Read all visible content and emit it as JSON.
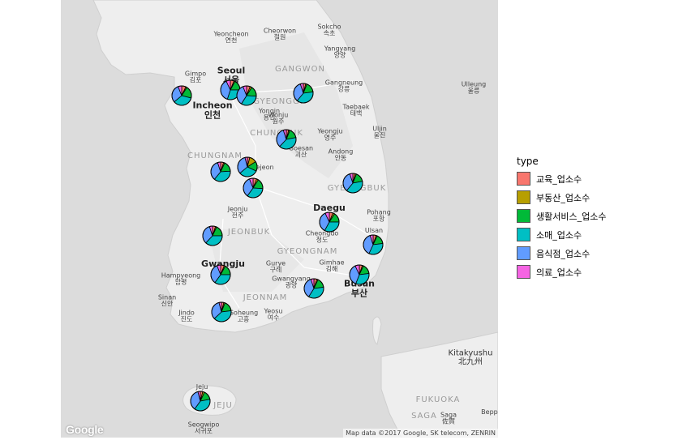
{
  "legend": {
    "title": "type",
    "items": [
      {
        "label": "교육_업소수",
        "color": "#F8766D"
      },
      {
        "label": "부동산_업소수",
        "color": "#B79F00"
      },
      {
        "label": "생활서비스_업소수",
        "color": "#00BA38"
      },
      {
        "label": "소매_업소수",
        "color": "#00BFC4"
      },
      {
        "label": "음식점_업소수",
        "color": "#619CFF"
      },
      {
        "label": "의료_업소수",
        "color": "#F564E3"
      }
    ]
  },
  "map": {
    "attribution": "Map data ©2017 Google, SK telecom, ZENRIN",
    "logo_text": "Google",
    "labels": [
      {
        "en": "Yeoncheon",
        "ko": "연천",
        "kind": "city"
      },
      {
        "en": "Cheorwon",
        "ko": "철원",
        "kind": "city"
      },
      {
        "en": "Sokcho",
        "ko": "속초",
        "kind": "city"
      },
      {
        "en": "Yangyang",
        "ko": "양양",
        "kind": "city"
      },
      {
        "en": "GANGWON",
        "ko": "",
        "kind": "region"
      },
      {
        "en": "Gimpo",
        "ko": "김포",
        "kind": "city"
      },
      {
        "en": "Seoul",
        "ko": "서울",
        "kind": "city-big"
      },
      {
        "en": "Gangneung",
        "ko": "강릉",
        "kind": "city"
      },
      {
        "en": "Ulleung",
        "ko": "울릉",
        "kind": "city"
      },
      {
        "en": "GYEONGGI",
        "ko": "",
        "kind": "region"
      },
      {
        "en": "Incheon",
        "ko": "인천",
        "kind": "city-big"
      },
      {
        "en": "Yongin",
        "ko": "용인",
        "kind": "city"
      },
      {
        "en": "Wonju",
        "ko": "원주",
        "kind": "city"
      },
      {
        "en": "Taebaek",
        "ko": "태백",
        "kind": "city"
      },
      {
        "en": "CHUNGBUK",
        "ko": "",
        "kind": "region"
      },
      {
        "en": "Yeongju",
        "ko": "영주",
        "kind": "city"
      },
      {
        "en": "Uljin",
        "ko": "울진",
        "kind": "city"
      },
      {
        "en": "Goesan",
        "ko": "괴산",
        "kind": "city"
      },
      {
        "en": "Andong",
        "ko": "안동",
        "kind": "city"
      },
      {
        "en": "CHUNGNAM",
        "ko": "",
        "kind": "region"
      },
      {
        "en": "Daejeon",
        "ko": "",
        "kind": "city"
      },
      {
        "en": "GYEONGBUK",
        "ko": "",
        "kind": "region"
      },
      {
        "en": "Jeonju",
        "ko": "전주",
        "kind": "city"
      },
      {
        "en": "Daegu",
        "ko": "",
        "kind": "city-big"
      },
      {
        "en": "Pohang",
        "ko": "포항",
        "kind": "city"
      },
      {
        "en": "JEONBUK",
        "ko": "",
        "kind": "region"
      },
      {
        "en": "Cheongdo",
        "ko": "청도",
        "kind": "city"
      },
      {
        "en": "Ulsan",
        "ko": "",
        "kind": "city"
      },
      {
        "en": "GYEONGNAM",
        "ko": "",
        "kind": "region"
      },
      {
        "en": "Gwangju",
        "ko": "",
        "kind": "city-big"
      },
      {
        "en": "Gurye",
        "ko": "구례",
        "kind": "city"
      },
      {
        "en": "Gimhae",
        "ko": "김해",
        "kind": "city"
      },
      {
        "en": "Hampyeong",
        "ko": "함평",
        "kind": "city"
      },
      {
        "en": "Gwangyang",
        "ko": "광양",
        "kind": "city"
      },
      {
        "en": "Busan",
        "ko": "부산",
        "kind": "city-big"
      },
      {
        "en": "JEONNAM",
        "ko": "",
        "kind": "region"
      },
      {
        "en": "Sinan",
        "ko": "신안",
        "kind": "city"
      },
      {
        "en": "Jindo",
        "ko": "진도",
        "kind": "city"
      },
      {
        "en": "Goheung",
        "ko": "고흥",
        "kind": "city"
      },
      {
        "en": "Yeosu",
        "ko": "여수",
        "kind": "city"
      },
      {
        "en": "Kitakyushu",
        "ko": "北九州",
        "kind": "intl"
      },
      {
        "en": "FUKUOKA",
        "ko": "",
        "kind": "region"
      },
      {
        "en": "SAGA",
        "ko": "",
        "kind": "region"
      },
      {
        "en": "Saga",
        "ko": "佐賀",
        "kind": "city"
      },
      {
        "en": "Beppu",
        "ko": "",
        "kind": "city"
      },
      {
        "en": "Jeju",
        "ko": "",
        "kind": "city"
      },
      {
        "en": "JEJU",
        "ko": "",
        "kind": "region"
      },
      {
        "en": "Seogwipo",
        "ko": "서귀포",
        "kind": "city"
      }
    ]
  },
  "pies": [
    {
      "name": "pie-incheon",
      "values": [
        0.07,
        0.02,
        0.2,
        0.35,
        0.3,
        0.06
      ]
    },
    {
      "name": "pie-seoul-west",
      "values": [
        0.06,
        0.02,
        0.17,
        0.3,
        0.38,
        0.07
      ]
    },
    {
      "name": "pie-seoul-east",
      "values": [
        0.06,
        0.03,
        0.17,
        0.33,
        0.35,
        0.06
      ]
    },
    {
      "name": "pie-gangwon",
      "values": [
        0.04,
        0.02,
        0.17,
        0.38,
        0.34,
        0.05
      ]
    },
    {
      "name": "pie-chungbuk",
      "values": [
        0.04,
        0.02,
        0.16,
        0.4,
        0.33,
        0.05
      ]
    },
    {
      "name": "pie-chungnam",
      "values": [
        0.05,
        0.02,
        0.17,
        0.37,
        0.34,
        0.05
      ]
    },
    {
      "name": "pie-sejong",
      "values": [
        0.04,
        0.12,
        0.16,
        0.32,
        0.32,
        0.04
      ]
    },
    {
      "name": "pie-daejeon",
      "values": [
        0.06,
        0.03,
        0.17,
        0.34,
        0.34,
        0.06
      ]
    },
    {
      "name": "pie-gyeongbuk",
      "values": [
        0.04,
        0.02,
        0.16,
        0.39,
        0.34,
        0.05
      ]
    },
    {
      "name": "pie-daegu",
      "values": [
        0.06,
        0.03,
        0.16,
        0.33,
        0.35,
        0.07
      ]
    },
    {
      "name": "pie-jeonbuk",
      "values": [
        0.05,
        0.02,
        0.18,
        0.37,
        0.33,
        0.05
      ]
    },
    {
      "name": "pie-ulsan",
      "values": [
        0.05,
        0.02,
        0.16,
        0.34,
        0.38,
        0.05
      ]
    },
    {
      "name": "pie-gwangju",
      "values": [
        0.06,
        0.02,
        0.17,
        0.35,
        0.34,
        0.06
      ]
    },
    {
      "name": "pie-busan",
      "values": [
        0.05,
        0.02,
        0.16,
        0.33,
        0.37,
        0.07
      ]
    },
    {
      "name": "pie-gyeongnam",
      "values": [
        0.05,
        0.02,
        0.16,
        0.36,
        0.36,
        0.05
      ]
    },
    {
      "name": "pie-jeonnam",
      "values": [
        0.04,
        0.02,
        0.17,
        0.4,
        0.33,
        0.04
      ]
    },
    {
      "name": "pie-jeju",
      "values": [
        0.04,
        0.03,
        0.15,
        0.38,
        0.36,
        0.04
      ]
    }
  ]
}
